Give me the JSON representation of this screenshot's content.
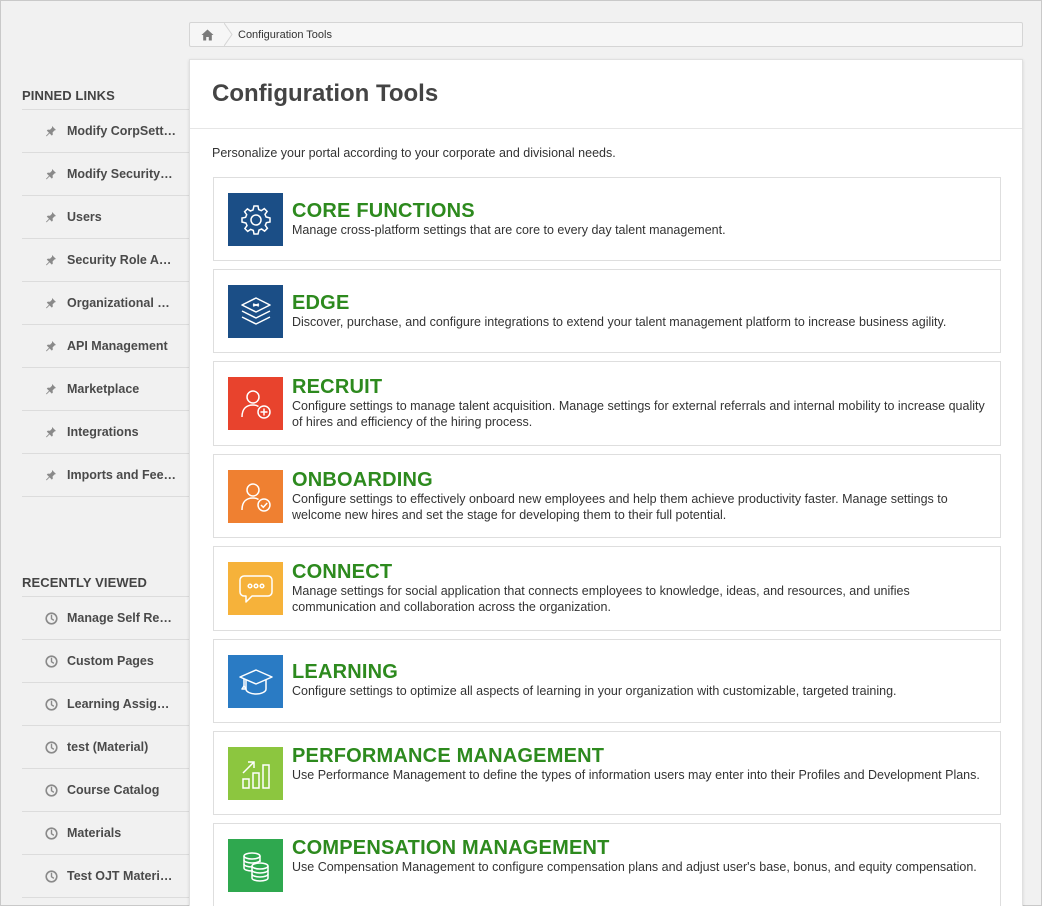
{
  "breadcrumb": {
    "home_icon": "home-icon",
    "current": "Configuration Tools"
  },
  "page": {
    "title": "Configuration Tools",
    "intro": "Personalize your portal according to your corporate and divisional needs."
  },
  "sidebar": {
    "pinned_heading": "PINNED LINKS",
    "pinned": [
      {
        "label": "Modify CorpSett…"
      },
      {
        "label": "Modify Security…"
      },
      {
        "label": "Users"
      },
      {
        "label": "Security Role A…"
      },
      {
        "label": "Organizational …"
      },
      {
        "label": "API Management"
      },
      {
        "label": "Marketplace"
      },
      {
        "label": "Integrations"
      },
      {
        "label": "Imports and Fee…"
      }
    ],
    "recent_heading": "RECENTLY VIEWED",
    "recent": [
      {
        "label": "Manage Self Re…"
      },
      {
        "label": "Custom Pages"
      },
      {
        "label": "Learning Assig…"
      },
      {
        "label": "test (Material)"
      },
      {
        "label": "Course Catalog"
      },
      {
        "label": "Materials"
      },
      {
        "label": "Test OJT Materi…"
      }
    ]
  },
  "tools": [
    {
      "title": "CORE FUNCTIONS",
      "desc": "Manage cross-platform settings that are core to every day talent management.",
      "icon": "gear-icon",
      "color": "#1b4e86"
    },
    {
      "title": "EDGE",
      "desc": "Discover, purchase, and configure integrations to extend your talent management platform to increase business agility.",
      "icon": "layers-icon",
      "color": "#1b4e86"
    },
    {
      "title": "RECRUIT",
      "desc": "Configure settings to manage talent acquisition. Manage settings for external referrals and internal mobility to increase quality of hires and efficiency of the hiring process.",
      "icon": "user-add-icon",
      "color": "#e8432d"
    },
    {
      "title": "ONBOARDING",
      "desc": "Configure settings to effectively onboard new employees and help them achieve productivity faster. Manage settings to welcome new hires and set the stage for developing them to their full potential.",
      "icon": "user-check-icon",
      "color": "#ef8031"
    },
    {
      "title": "CONNECT",
      "desc": "Manage settings for social application that connects employees to knowledge, ideas, and resources, and unifies communication and collaboration across the organization.",
      "icon": "chat-bubble-icon",
      "color": "#f6b23a"
    },
    {
      "title": "LEARNING",
      "desc": "Configure settings to optimize all aspects of learning in your organization with customizable, targeted training.",
      "icon": "graduation-cap-icon",
      "color": "#2a7bc4"
    },
    {
      "title": "PERFORMANCE MANAGEMENT",
      "desc": "Use Performance Management to define the  types of information users may enter into their Profiles and Development Plans.",
      "icon": "growth-chart-icon",
      "color": "#8cc63f"
    },
    {
      "title": "COMPENSATION MANAGEMENT",
      "desc": "Use Compensation Management to configure compensation plans and adjust user's base, bonus, and equity compensation.",
      "icon": "coins-icon",
      "color": "#2fa84f"
    }
  ]
}
